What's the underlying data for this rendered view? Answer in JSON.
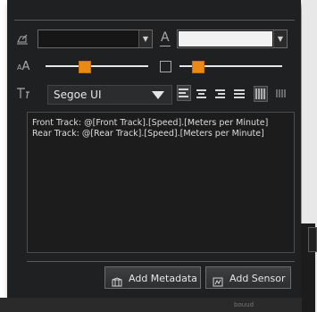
{
  "text_panel": {
    "font_family": "Segoe UI",
    "text_lines": [
      "Front Track: @[Front Track].[Speed].[Meters per Minute]",
      "Rear Track: @[Rear Track].[Speed].[Meters per Minute]"
    ],
    "size_slider_value": 0.38,
    "opacity_slider_value": 0.18,
    "alignment_options": [
      "align-left",
      "align-center",
      "align-right",
      "justify",
      "justify-all",
      "distribute"
    ],
    "selected_alignment": "align-left"
  },
  "buttons": {
    "add_metadata": "Add Metadata",
    "add_sensor": "Add Sensor"
  },
  "footer": {
    "hint": "bouud"
  },
  "colors": {
    "panel_bg": "#1f2021",
    "accent": "#e88a14",
    "text": "#dedede"
  }
}
